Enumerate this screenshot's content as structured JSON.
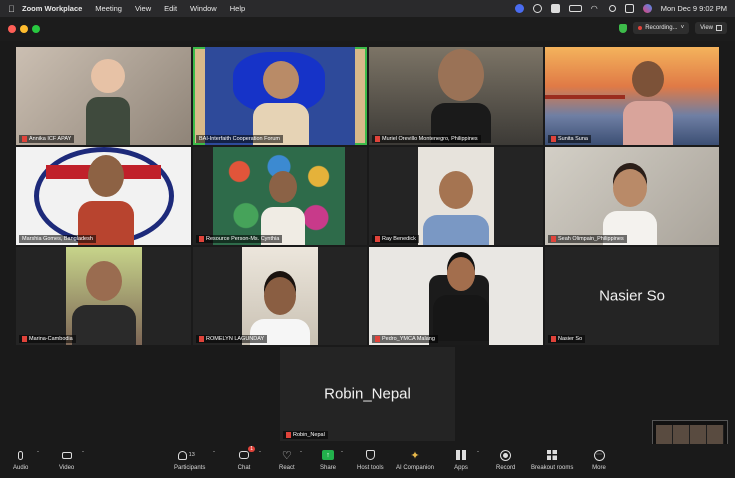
{
  "menubar": {
    "app": "Zoom Workplace",
    "items": [
      "Meeting",
      "View",
      "Edit",
      "Window",
      "Help"
    ],
    "clock": "Mon Dec 9  9:02 PM"
  },
  "titlebar": {
    "recording_label": "Recording...",
    "view_label": "View"
  },
  "participants": [
    {
      "name": "Annika ICF APAY",
      "muted": true
    },
    {
      "name": "BAI-Interfaith Cooperation Forum",
      "muted": false,
      "active": true
    },
    {
      "name": "Muriel Orevillo Montenegro, Philippines",
      "muted": true
    },
    {
      "name": "Sunita Suna",
      "muted": true
    },
    {
      "name": "Marshia Gomes, Bangladesh",
      "muted": false
    },
    {
      "name": "Resource Person-Ms. Cynthia",
      "muted": true
    },
    {
      "name": "Ray Benedick",
      "muted": true
    },
    {
      "name": "Seah Olimpain_Philippines",
      "muted": true
    },
    {
      "name": "Marina-Cambodia",
      "muted": true
    },
    {
      "name": "ROMELYN LAGUNDAY",
      "muted": true
    },
    {
      "name": "Pedro_YMCA Malang",
      "muted": true
    },
    {
      "name": "Nasier So",
      "muted": true,
      "big": "Nasier So"
    },
    {
      "name": "Robin_Nepal",
      "muted": true,
      "big": "Robin_Nepal"
    }
  ],
  "toolbar": {
    "audio": "Audio",
    "video": "Video",
    "participants": "Participants",
    "participants_count": "13",
    "chat": "Chat",
    "chat_badge": "1",
    "react": "React",
    "share": "Share",
    "host_tools": "Host tools",
    "ai_companion": "AI Companion",
    "apps": "Apps",
    "record": "Record",
    "breakout": "Breakout rooms",
    "more": "More"
  },
  "colors": {
    "accent_green": "#3dbb4a",
    "record_red": "#e0433a",
    "share_green": "#22b14c"
  }
}
